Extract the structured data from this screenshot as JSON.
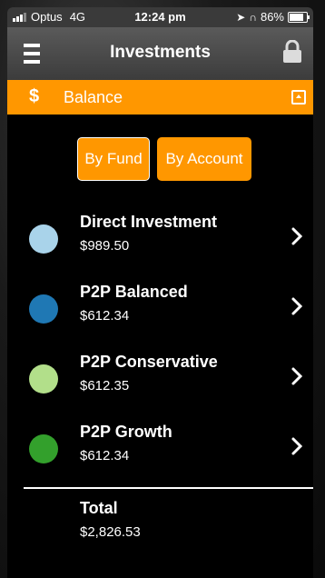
{
  "status_bar": {
    "carrier": "Optus",
    "network": "4G",
    "time": "12:24 pm",
    "battery": "86%"
  },
  "nav": {
    "title": "Investments"
  },
  "balance_bar": {
    "icon_text": "$",
    "label": "Balance"
  },
  "toggle": {
    "by_fund": "By Fund",
    "by_account": "By Account",
    "selected": "By Fund"
  },
  "funds": [
    {
      "name": "Direct Investment",
      "value": "$989.50",
      "color": "#a9d3ea"
    },
    {
      "name": "P2P Balanced",
      "value": "$612.34",
      "color": "#1f78b4"
    },
    {
      "name": "P2P Conservative",
      "value": "$612.35",
      "color": "#b2df8a"
    },
    {
      "name": "P2P Growth",
      "value": "$612.34",
      "color": "#33a02c"
    }
  ],
  "total": {
    "label": "Total",
    "value": "$2,826.53"
  },
  "colors": {
    "accent": "#ff9700",
    "background": "#000000"
  }
}
